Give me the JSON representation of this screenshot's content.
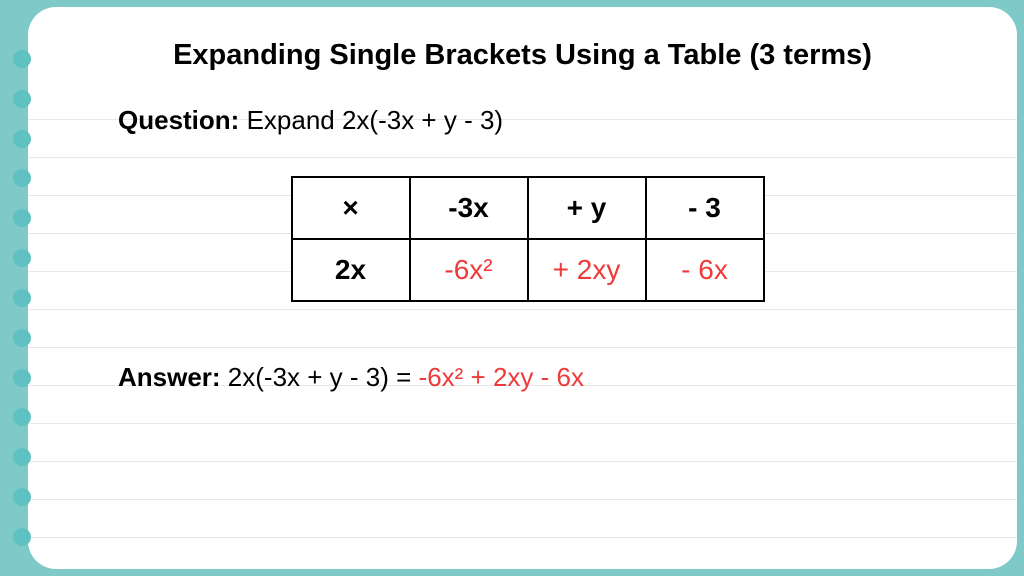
{
  "title": "Expanding Single Brackets Using a Table (3 terms)",
  "question": {
    "label": "Question:",
    "text": " Expand 2x(-3x + y - 3)"
  },
  "table": {
    "r0c0": "×",
    "r0c1": "-3x",
    "r0c2": "+ y",
    "r0c3": "- 3",
    "r1c0": "2x",
    "r1c1": "-6x²",
    "r1c2": "+ 2xy",
    "r1c3": "- 6x"
  },
  "answer": {
    "label": "Answer:",
    "lhs": " 2x(-3x + y - 3) = ",
    "rhs": "-6x² + 2xy - 6x"
  }
}
